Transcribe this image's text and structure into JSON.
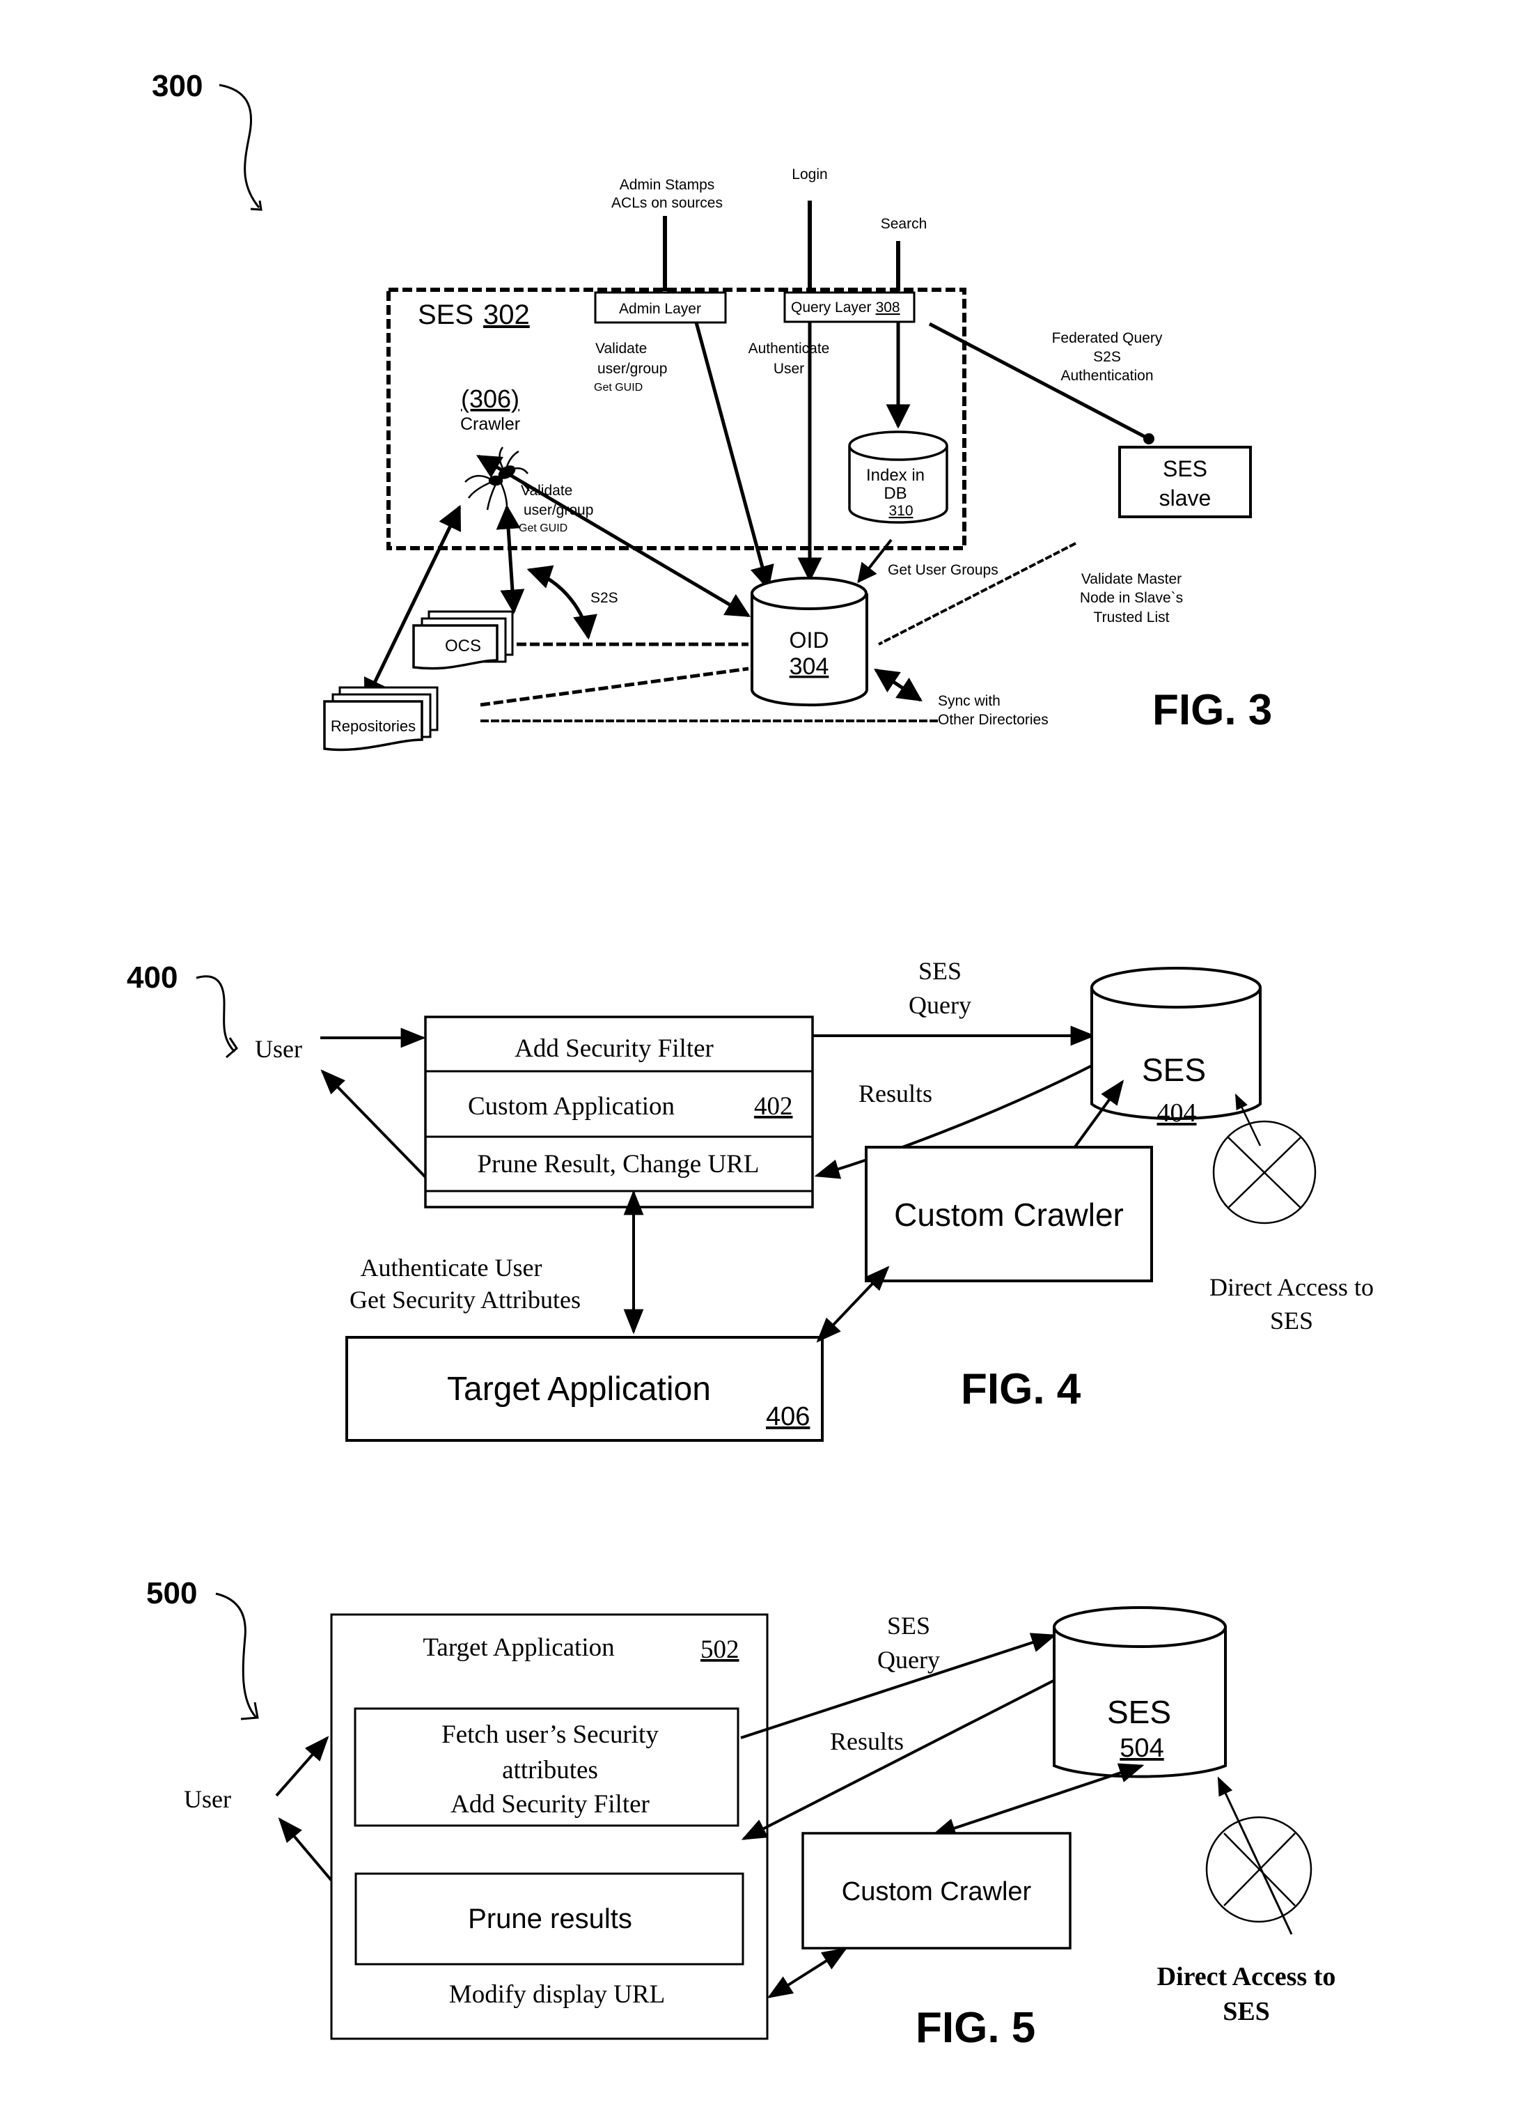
{
  "colors": {
    "ink": "#000000",
    "paper": "#ffffff"
  },
  "fig3": {
    "ref_number": "300",
    "caption": "FIG. 3",
    "inputs": {
      "admin": [
        "Admin Stamps",
        "ACLs  on sources"
      ],
      "login": "Login",
      "search": "Search"
    },
    "ses_box": {
      "title": "SES",
      "ref": "302"
    },
    "admin_layer": "Admin Layer",
    "query_layer": {
      "label": "Query Layer",
      "ref": "308"
    },
    "crawler": {
      "ref": "(306)",
      "label": "Crawler",
      "icon": "spider-icon"
    },
    "validate_admin": [
      "Validate",
      "user/group",
      "Get GUID"
    ],
    "authenticate_user": [
      "Authenticate",
      "User"
    ],
    "validate_crawler": [
      "Validate",
      "user/group",
      "Get GUID"
    ],
    "index_db": {
      "lines": [
        "Index in",
        "DB"
      ],
      "ref": "310"
    },
    "federated_query": [
      "Federated Query",
      "S2S",
      "Authentication"
    ],
    "ses_slave": [
      "SES",
      "slave"
    ],
    "get_user_groups": "Get User Groups",
    "validate_master": [
      "Validate Master",
      "Node in Slave`s",
      "Trusted List"
    ],
    "s2s": "S2S",
    "ocs": "OCS",
    "oid": {
      "label": "OID",
      "ref": "304"
    },
    "repositories": "Repositories",
    "sync": [
      "Sync with",
      "Other Directories"
    ]
  },
  "fig4": {
    "ref_number": "400",
    "caption": "FIG. 4",
    "user": "User",
    "custom_app_rows": [
      "Add Security Filter",
      "Custom Application",
      "Prune Result, Change URL"
    ],
    "custom_app_ref": "402",
    "ses_query": [
      "SES",
      "Query"
    ],
    "results": "Results",
    "ses": {
      "label": "SES",
      "ref": "404"
    },
    "custom_crawler": "Custom Crawler",
    "direct_access": [
      "Direct  Access to",
      "SES"
    ],
    "auth_label": [
      "Authenticate User",
      "Get Security Attributes"
    ],
    "target_app": {
      "label": "Target Application",
      "ref": "406"
    }
  },
  "fig5": {
    "ref_number": "500",
    "caption": "FIG. 5",
    "user": "User",
    "target_app": {
      "label": "Target Application",
      "ref": "502"
    },
    "fetch_box": [
      "Fetch user’s Security",
      "attributes",
      "Add Security Filter"
    ],
    "prune_box": "Prune results",
    "modify_url": "Modify display URL",
    "ses_query": [
      "SES",
      "Query"
    ],
    "results": "Results",
    "ses": {
      "label": "SES",
      "ref": "504"
    },
    "custom_crawler": "Custom Crawler",
    "direct_access": [
      "Direct Access to",
      "SES"
    ]
  }
}
